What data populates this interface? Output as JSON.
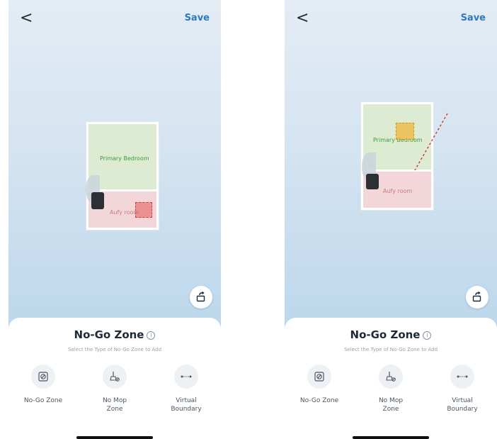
{
  "screens": [
    {
      "back_label": "<",
      "save_label": "Save",
      "rooms": {
        "primary": "Primary Bedroom",
        "secondary": "Aufy room"
      },
      "sheet": {
        "title": "No-Go Zone",
        "info": "i",
        "subtitle": "Select the Type of No-Go Zone to Add",
        "options": [
          {
            "label": "No-Go Zone",
            "icon": "no-go-zone-icon"
          },
          {
            "label": "No Mop Zone",
            "icon": "no-mop-icon"
          },
          {
            "label": "Virtual Boundary",
            "icon": "virtual-boundary-icon"
          }
        ]
      }
    },
    {
      "back_label": "<",
      "save_label": "Save",
      "rooms": {
        "primary": "Primary Bedroom",
        "secondary": "Aufy room"
      },
      "sheet": {
        "title": "No-Go Zone",
        "info": "i",
        "subtitle": "Select the Type of No-Go Zone to Add",
        "options": [
          {
            "label": "No-Go Zone",
            "icon": "no-go-zone-icon"
          },
          {
            "label": "No Mop Zone",
            "icon": "no-mop-icon"
          },
          {
            "label": "Virtual Boundary",
            "icon": "virtual-boundary-icon"
          }
        ]
      }
    }
  ],
  "colors": {
    "accent": "#2f78c4",
    "no_go_red": "#d63b3b",
    "no_mop_amber": "#f2b83c",
    "room_green": "#dcebd2",
    "room_pink": "#f2d6d9"
  }
}
